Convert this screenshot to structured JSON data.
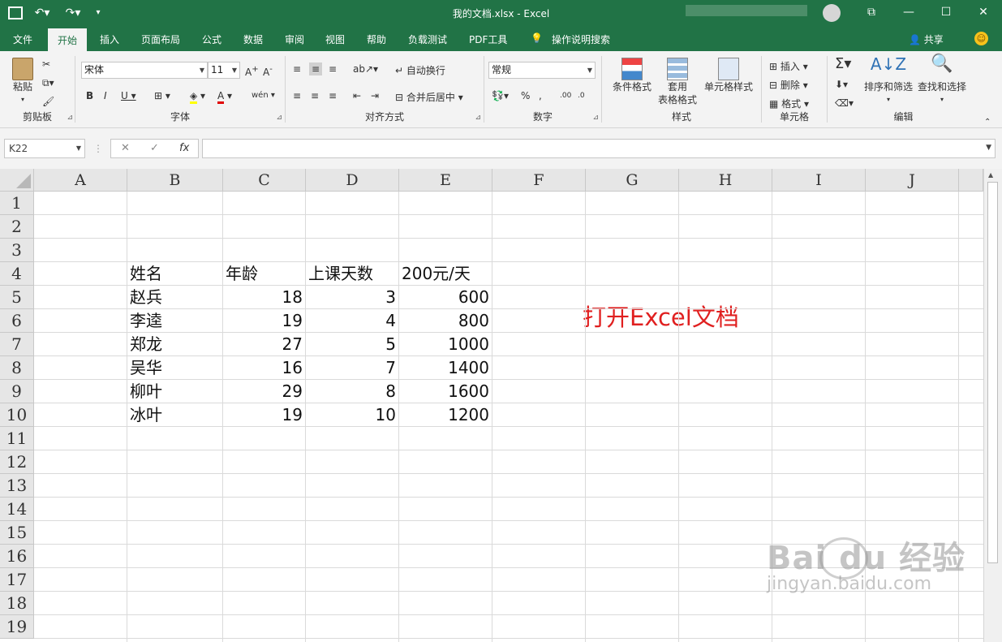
{
  "titlebar": {
    "title": "我的文档.xlsx  -  Excel",
    "qat": {
      "save_icon": "save-icon",
      "undo_icon": "undo-icon",
      "redo_icon": "redo-icon",
      "customize_icon": "customize-qat-icon"
    },
    "window_buttons": {
      "ribbon_display": "ribbon-display-icon",
      "minimize": "minimize-icon",
      "maximize": "maximize-icon",
      "close": "close-icon"
    }
  },
  "tabs": {
    "file": "文件",
    "home": "开始",
    "insert": "插入",
    "page_layout": "页面布局",
    "formulas": "公式",
    "data": "数据",
    "review": "审阅",
    "view": "视图",
    "help": "帮助",
    "load_test": "负载测试",
    "pdf_tools": "PDF工具",
    "tell_me": "操作说明搜索",
    "share": "共享"
  },
  "ribbon": {
    "clipboard": {
      "label": "剪贴板",
      "paste": "粘贴"
    },
    "font": {
      "label": "字体",
      "font_name": "宋体",
      "font_size": "11"
    },
    "alignment": {
      "label": "对齐方式",
      "wrap_text": "自动换行",
      "merge_center": "合并后居中"
    },
    "number": {
      "label": "数字",
      "format": "常规"
    },
    "styles": {
      "label": "样式",
      "conditional": "条件格式",
      "table_fmt_1": "套用",
      "table_fmt_2": "表格格式",
      "cell_styles": "单元格样式"
    },
    "cells": {
      "label": "单元格",
      "insert": "插入",
      "delete": "删除",
      "format": "格式"
    },
    "editing": {
      "label": "编辑",
      "sort_filter": "排序和筛选",
      "find_select": "查找和选择"
    }
  },
  "formula_bar": {
    "name_box": "K22",
    "formula": ""
  },
  "columns": [
    "A",
    "B",
    "C",
    "D",
    "E",
    "F",
    "G",
    "H",
    "I",
    "J"
  ],
  "rows": [
    "1",
    "2",
    "3",
    "4",
    "5",
    "6",
    "7",
    "8",
    "9",
    "10",
    "11",
    "12",
    "13",
    "14",
    "15",
    "16",
    "17",
    "18",
    "19"
  ],
  "table": {
    "headers": [
      "姓名",
      "年龄",
      "上课天数",
      "200元/天"
    ],
    "rows": [
      [
        "赵兵",
        "18",
        "3",
        "600"
      ],
      [
        "李逵",
        "19",
        "4",
        "800"
      ],
      [
        "郑龙",
        "27",
        "5",
        "1000"
      ],
      [
        "吴华",
        "16",
        "7",
        "1400"
      ],
      [
        "柳叶",
        "29",
        "8",
        "1600"
      ],
      [
        "冰叶",
        "19",
        "10",
        "1200"
      ]
    ]
  },
  "annotation": "打开Excel文档",
  "watermark": {
    "brand": "Bai du 经验",
    "url": "jingyan.baidu.com"
  }
}
